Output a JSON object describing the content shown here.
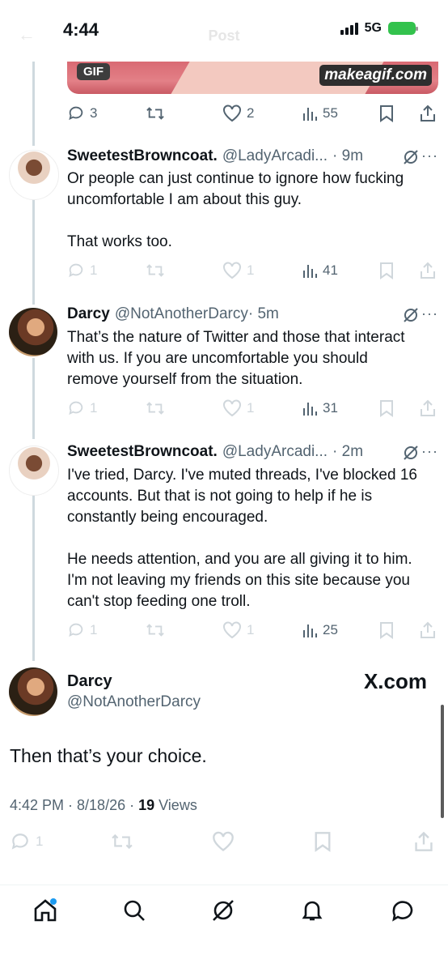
{
  "status": {
    "time": "4:44",
    "network": "5G"
  },
  "header": {
    "title": "Post"
  },
  "gif": {
    "badge": "GIF",
    "watermark": "makeagif.com"
  },
  "top_tweet_actions": {
    "replies": "3",
    "likes": "2",
    "views": "55"
  },
  "tweets": [
    {
      "name": "SweetestBrowncoat.",
      "handle": "@LadyArcadi...",
      "time": "· 9m",
      "text": "Or people can just continue to ignore how fucking uncomfortable I am about this guy.\n\nThat works too.",
      "replies": "1",
      "likes": "1",
      "views": "41"
    },
    {
      "name": "Darcy",
      "handle": "@NotAnotherDarcy",
      "time": "· 5m",
      "text": "That’s the nature of Twitter and those that interact with us. If you are uncomfortable you should remove yourself from the situation.",
      "replies": "1",
      "likes": "1",
      "views": "31"
    },
    {
      "name": "SweetestBrowncoat.",
      "handle": "@LadyArcadi...",
      "time": "· 2m",
      "text": "I've tried, Darcy. I've muted threads, I've blocked 16 accounts. But that is not going to help if he is constantly being encouraged.\n\nHe needs attention, and you are all giving it to him. I'm not leaving my friends on this site because you can't stop feeding one troll.",
      "replies": "1",
      "likes": "1",
      "views": "25"
    }
  ],
  "main_tweet": {
    "name": "Darcy",
    "handle": "@NotAnotherDarcy",
    "watermark": "X.com",
    "text": "Then that’s your choice.",
    "timestamp": "4:42 PM · 8/18/26 · ",
    "views_count": "19",
    "views_label": " Views",
    "replies": "1"
  },
  "colors": {
    "accent": "#1d9bf0",
    "secondary": "#536471",
    "faded": "#d0d7dc",
    "thread_line": "#cfd9de"
  }
}
